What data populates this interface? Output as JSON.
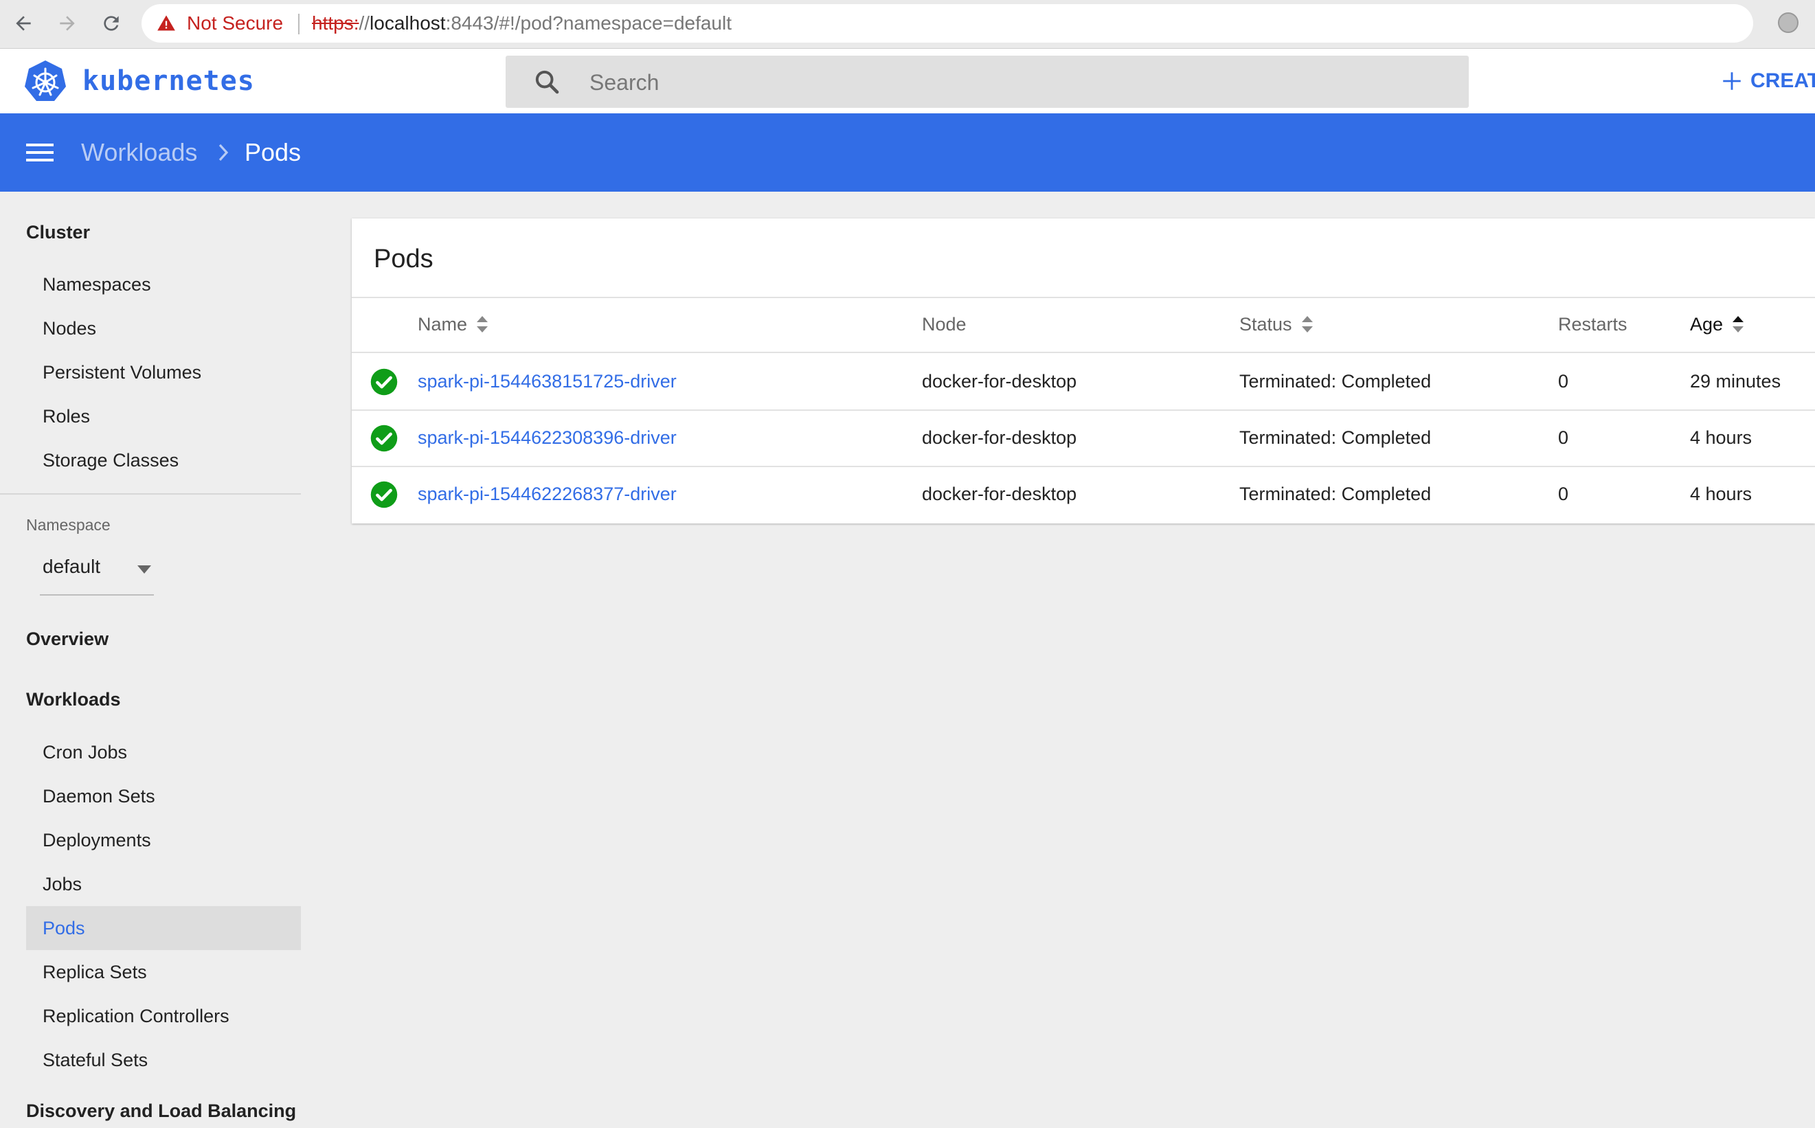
{
  "browser": {
    "security_label": "Not Secure",
    "url_scheme": "https:",
    "url_slashes": "//",
    "url_host": "localhost",
    "url_rest": ":8443/#!/pod?namespace=default"
  },
  "header": {
    "logo_text": "kubernetes",
    "search_placeholder": "Search",
    "create_label": "CREATE"
  },
  "breadcrumb": {
    "parent": "Workloads",
    "current": "Pods"
  },
  "sidebar": {
    "cluster_heading": "Cluster",
    "cluster_items": [
      "Namespaces",
      "Nodes",
      "Persistent Volumes",
      "Roles",
      "Storage Classes"
    ],
    "namespace_label": "Namespace",
    "namespace_value": "default",
    "overview_heading": "Overview",
    "workloads_heading": "Workloads",
    "workload_items": [
      "Cron Jobs",
      "Daemon Sets",
      "Deployments",
      "Jobs",
      "Pods",
      "Replica Sets",
      "Replication Controllers",
      "Stateful Sets"
    ],
    "active_item": "Pods",
    "discovery_heading": "Discovery and Load Balancing"
  },
  "pods": {
    "title": "Pods",
    "columns": [
      "Name",
      "Node",
      "Status",
      "Restarts",
      "Age"
    ],
    "rows": [
      {
        "name": "spark-pi-1544638151725-driver",
        "node": "docker-for-desktop",
        "status": "Terminated: Completed",
        "restarts": "0",
        "age": "29 minutes"
      },
      {
        "name": "spark-pi-1544622308396-driver",
        "node": "docker-for-desktop",
        "status": "Terminated: Completed",
        "restarts": "0",
        "age": "4 hours"
      },
      {
        "name": "spark-pi-1544622268377-driver",
        "node": "docker-for-desktop",
        "status": "Terminated: Completed",
        "restarts": "0",
        "age": "4 hours"
      }
    ]
  },
  "colors": {
    "brand": "#326de6",
    "success": "#0f9d18",
    "warning": "#c5221f"
  }
}
